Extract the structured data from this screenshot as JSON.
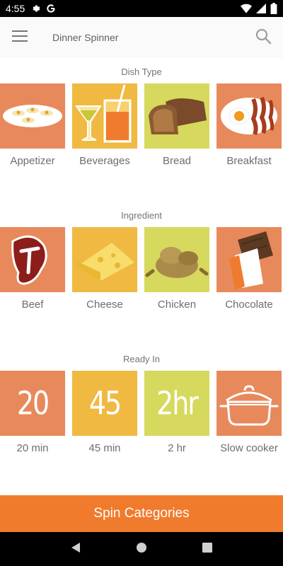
{
  "status_bar": {
    "time": "4:55"
  },
  "app_bar": {
    "title": "Dinner Spinner"
  },
  "sections": [
    {
      "title": "Dish Type",
      "items": [
        {
          "label": "Appetizer",
          "icon": "appetizer-icon",
          "bg": "#e8895c"
        },
        {
          "label": "Beverages",
          "icon": "beverages-icon",
          "bg": "#f0b942"
        },
        {
          "label": "Bread",
          "icon": "bread-icon",
          "bg": "#d6d95d"
        },
        {
          "label": "Breakfast",
          "icon": "breakfast-icon",
          "bg": "#e8895c"
        }
      ]
    },
    {
      "title": "Ingredient",
      "items": [
        {
          "label": "Beef",
          "icon": "beef-icon",
          "bg": "#e8895c"
        },
        {
          "label": "Cheese",
          "icon": "cheese-icon",
          "bg": "#f0b942"
        },
        {
          "label": "Chicken",
          "icon": "chicken-icon",
          "bg": "#d6d95d"
        },
        {
          "label": "Chocolate",
          "icon": "chocolate-icon",
          "bg": "#e8895c"
        }
      ]
    },
    {
      "title": "Ready In",
      "items": [
        {
          "label": "20 min",
          "tile_text": "20",
          "bg": "#e8895c"
        },
        {
          "label": "45 min",
          "tile_text": "45",
          "bg": "#f0b942"
        },
        {
          "label": "2 hr",
          "tile_text": "2hr",
          "bg": "#d6d95d"
        },
        {
          "label": "Slow cooker",
          "icon": "slow-cooker-icon",
          "bg": "#e8895c"
        }
      ]
    }
  ],
  "spin_button": {
    "label": "Spin Categories"
  },
  "colors": {
    "accent": "#f07b2c",
    "orange_tile": "#e8895c",
    "yellow_tile": "#f0b942",
    "green_tile": "#d6d95d"
  }
}
